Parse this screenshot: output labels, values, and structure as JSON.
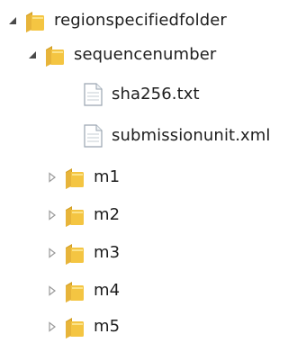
{
  "tree": {
    "root": {
      "label": "regionspecifiedfolder",
      "expanded": true,
      "icon": "folder-open-icon"
    },
    "sequence": {
      "label": "sequencenumber",
      "expanded": true,
      "icon": "folder-open-icon"
    },
    "files": [
      {
        "label": "sha256.txt",
        "icon": "text-file-icon"
      },
      {
        "label": "submissionunit.xml",
        "icon": "text-file-icon"
      }
    ],
    "modules": [
      {
        "label": "m1",
        "expanded": false,
        "icon": "folder-icon"
      },
      {
        "label": "m2",
        "expanded": false,
        "icon": "folder-icon"
      },
      {
        "label": "m3",
        "expanded": false,
        "icon": "folder-icon"
      },
      {
        "label": "m4",
        "expanded": false,
        "icon": "folder-icon"
      },
      {
        "label": "m5",
        "expanded": false,
        "icon": "folder-icon"
      }
    ]
  },
  "colors": {
    "folder_yellow": "#f4c542",
    "folder_dark": "#d39f22",
    "text": "#1e1e1e",
    "expander": "#4a4a4a",
    "expander_collapsed": "#9a9a9a",
    "file_body": "#ffffff",
    "file_border": "#9aa5b1"
  }
}
